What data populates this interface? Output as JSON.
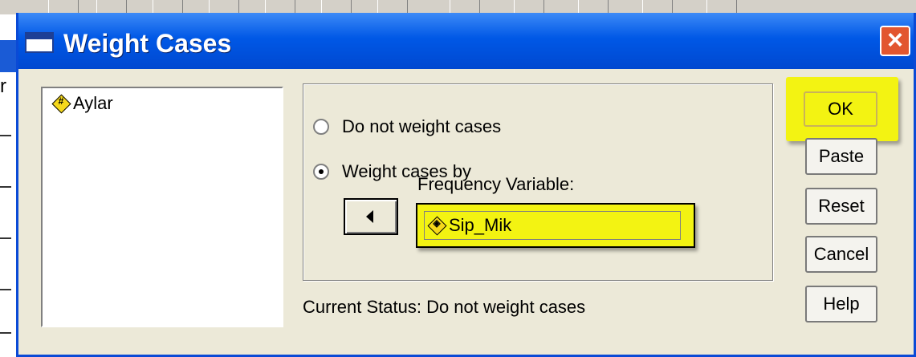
{
  "window": {
    "title": "Weight Cases",
    "close_label": "×"
  },
  "background": {
    "edge_char": "r"
  },
  "variable_list": {
    "items": [
      {
        "name": "Aylar",
        "icon": "numeric-variable-icon",
        "glyph": "#"
      }
    ]
  },
  "weighting": {
    "options": [
      {
        "label": "Do not weight cases",
        "selected": false
      },
      {
        "label": "Weight cases by",
        "selected": true
      }
    ],
    "frequency_label": "Frequency Variable:",
    "frequency_value": "Sip_Mik",
    "frequency_icon": "scale-variable-icon"
  },
  "status": {
    "text": "Current Status:  Do not weight cases"
  },
  "buttons": {
    "ok": "OK",
    "paste": "Paste",
    "reset": "Reset",
    "cancel": "Cancel",
    "help": "Help"
  },
  "colors": {
    "highlight": "#f3f312",
    "titlebar": "#0058e6",
    "dialog_bg": "#ece9d8"
  }
}
